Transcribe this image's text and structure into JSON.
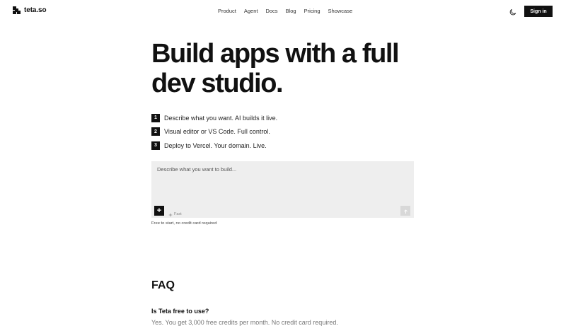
{
  "nav": {
    "brand": "teta.so",
    "links": [
      "Product",
      "Agent",
      "Docs",
      "Blog",
      "Pricing",
      "Showcase"
    ],
    "theme_icon": "moon-icon",
    "signin_label": "Sign in"
  },
  "hero": {
    "headline": "Build apps with a full dev studio.",
    "steps": [
      {
        "num": "1",
        "text": "Describe what you want. AI builds it live."
      },
      {
        "num": "2",
        "text": "Visual editor or VS Code. Full control."
      },
      {
        "num": "3",
        "text": "Deploy to Vercel. Your domain. Live."
      }
    ]
  },
  "prompt": {
    "placeholder": "Describe what you want to build...",
    "add_label": "+",
    "mode_label": "Fast",
    "mode_icon": "sparkle-icon",
    "send_icon": "arrow-up-icon",
    "note": "Free to start, no credit card required"
  },
  "faq": {
    "title": "FAQ",
    "items": [
      {
        "question": "Is Teta free to use?",
        "answer": "Yes. You get 3,000 free credits per month. No credit card required."
      }
    ]
  }
}
